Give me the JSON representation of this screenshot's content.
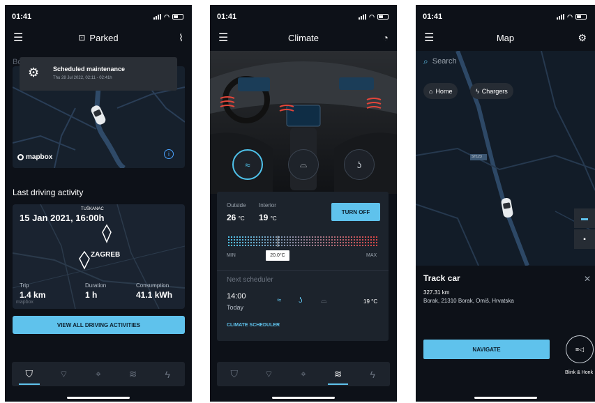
{
  "status_bar": {
    "time": "01:41"
  },
  "screen_parked": {
    "title": "Parked",
    "background_text": "Bo",
    "notification": {
      "title": "Scheduled maintenance",
      "subtitle": "Thu 28 Jul 2022, 02:11 - 02:41h"
    },
    "map_attribution": "mapbox",
    "section_title": "Last driving activity",
    "activity": {
      "date": "15 Jan 2021, 16:00h",
      "top_place": "TUŠKANAC",
      "place": "ZAGREB",
      "trip_label": "Trip",
      "trip_value": "1.4 km",
      "duration_label": "Duration",
      "duration_value": "1 h",
      "consumption_label": "Consumption",
      "consumption_value": "41.1 kWh",
      "attribution": "mapbox"
    },
    "view_all_button": "VIEW ALL DRIVING ACTIVITIES",
    "active_tab_index": 0
  },
  "screen_climate": {
    "title": "Climate",
    "outside_label": "Outside",
    "outside_value": "26",
    "outside_unit": "°C",
    "interior_label": "Interior",
    "interior_value": "19",
    "interior_unit": "°C",
    "turn_off_button": "TURN OFF",
    "slider_min": "MIN",
    "slider_max": "MAX",
    "slider_value": "20.0°C",
    "next_scheduler_label": "Next scheduler",
    "scheduler_time": "14:00",
    "scheduler_day": "Today",
    "scheduler_temp": "19 °C",
    "climate_scheduler_link": "CLIMATE SCHEDULER",
    "active_tab_index": 3
  },
  "screen_map": {
    "title": "Map",
    "search_placeholder": "Search",
    "chip_home": "Home",
    "chip_chargers": "Chargers",
    "road_label": "ST123",
    "track_title": "Track car",
    "track_distance": "327.31 km",
    "track_address": "Borak, 21310 Borak, Omiš, Hrvatska",
    "navigate_button": "NAVIGATE",
    "blink_label": "Blink & Honk"
  },
  "colors": {
    "accent": "#5fc2ec",
    "background": "#0d1118",
    "card": "#1c232c"
  },
  "icons": {
    "tabs": [
      "shield-icon",
      "car-route-icon",
      "map-pin-icon",
      "climate-fan-icon",
      "charging-icon"
    ]
  }
}
